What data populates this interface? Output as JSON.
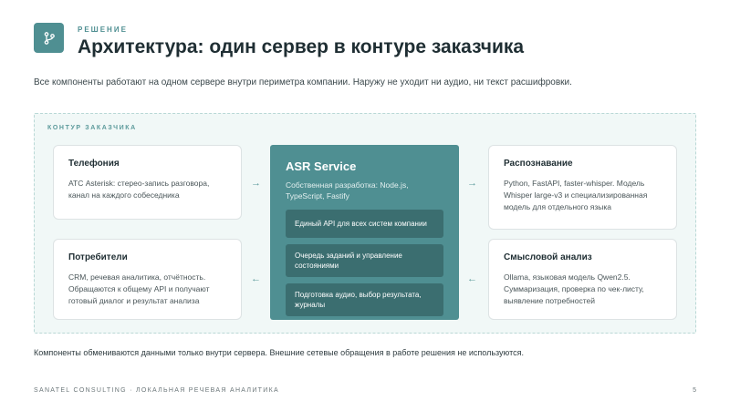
{
  "header": {
    "kicker": "РЕШЕНИЕ",
    "title": "Архитектура: один сервер в контуре заказчика",
    "icon": "git-branch-icon",
    "accent": "#4f8f92"
  },
  "lead": "Все компоненты работают на одном сервере внутри периметра компании. Наружу не уходит ни аудио, ни текст расшифровки.",
  "perimeter": {
    "label": "КОНТУР ЗАКАЗЧИКА"
  },
  "cards": {
    "telephony": {
      "title": "Телефония",
      "text": "АТС Asterisk: стерео-запись разговора, канал на каждого собеседника"
    },
    "consumers": {
      "title": "Потребители",
      "text": "CRM, речевая аналитика, отчётность. Обращаются к общему API и получают готовый диалог и результат анализа"
    },
    "recognition": {
      "title": "Распознавание",
      "text": "Python, FastAPI, faster-whisper. Модель Whisper large-v3 и специализированная модель для отдельного языка"
    },
    "semantic": {
      "title": "Смысловой анализ",
      "text": "Ollama, языковая модель Qwen2.5. Суммаризация, проверка по чек-листу, выявление потребностей"
    }
  },
  "center": {
    "title": "ASR Service",
    "subtitle": "Собственная разработка: Node.js, TypeScript, Fastify",
    "modules": [
      "Единый API для всех систем компании",
      "Очередь заданий и управление состояниями",
      "Подготовка аудио, выбор результата, журналы"
    ]
  },
  "arrows": {
    "right": "→",
    "left": "←"
  },
  "footnote": "Компоненты обмениваются данными только внутри сервера. Внешние сетевые обращения в работе решения не используются.",
  "footer": {
    "left": "SANATEL CONSULTING · ЛОКАЛЬНАЯ РЕЧЕВАЯ АНАЛИТИКА",
    "page": "5"
  }
}
